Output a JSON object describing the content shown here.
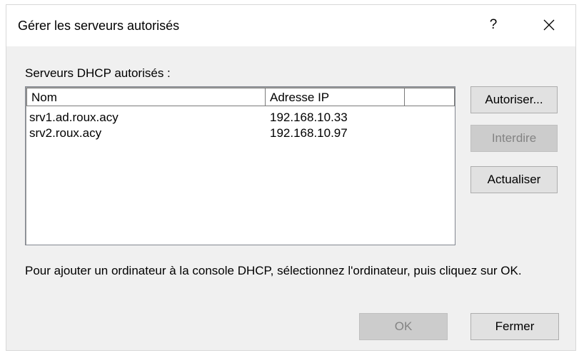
{
  "window": {
    "title": "Gérer les serveurs autorisés",
    "help_label": "?",
    "close_icon": "close-icon"
  },
  "servers_group": {
    "label": "Serveurs DHCP autorisés :",
    "columns": [
      "Nom",
      "Adresse IP",
      ""
    ],
    "rows": [
      {
        "name": "srv1.ad.roux.acy",
        "ip": "192.168.10.33"
      },
      {
        "name": "srv2.roux.acy",
        "ip": "192.168.10.97"
      }
    ]
  },
  "side_buttons": {
    "authorize": "Autoriser...",
    "deny": "Interdire",
    "refresh": "Actualiser"
  },
  "instruction": "Pour ajouter un ordinateur à la console DHCP, sélectionnez l'ordinateur, puis cliquez sur OK.",
  "footer": {
    "ok": "OK",
    "close": "Fermer"
  },
  "colors": {
    "dialog_bg": "#f0f0f0",
    "title_bg": "#ffffff",
    "focus_border": "#0078d7",
    "disabled_text": "#838383"
  }
}
